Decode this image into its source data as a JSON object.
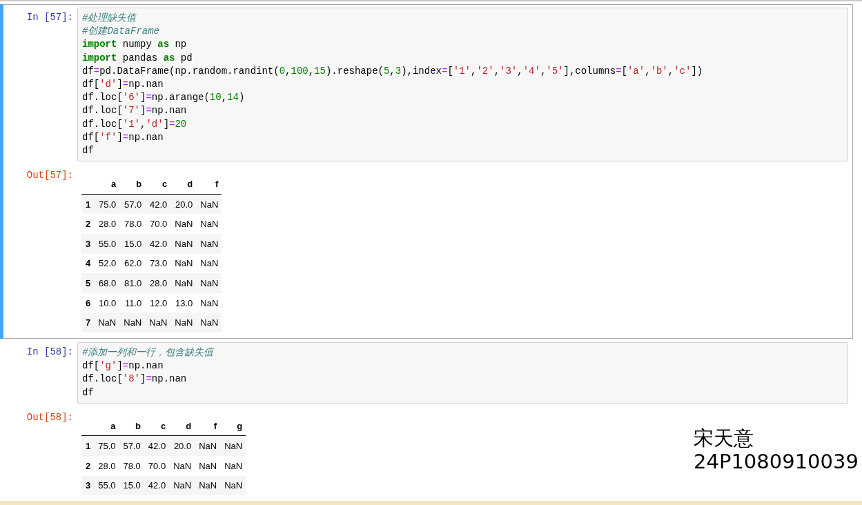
{
  "cells": [
    {
      "selected": true,
      "in_prompt": "In [57]:",
      "code": [
        [
          {
            "kind": "comment",
            "text": "#处理缺失值"
          }
        ],
        [
          {
            "kind": "comment",
            "text": "#创建DataFrame"
          }
        ],
        [
          {
            "kind": "keyword",
            "text": "import"
          },
          {
            "kind": "name",
            "text": " numpy "
          },
          {
            "kind": "keyword",
            "text": "as"
          },
          {
            "kind": "name",
            "text": " np"
          }
        ],
        [
          {
            "kind": "keyword",
            "text": "import"
          },
          {
            "kind": "name",
            "text": " pandas "
          },
          {
            "kind": "keyword",
            "text": "as"
          },
          {
            "kind": "name",
            "text": " pd"
          }
        ],
        [
          {
            "kind": "name",
            "text": "df"
          },
          {
            "kind": "operator",
            "text": "="
          },
          {
            "kind": "name",
            "text": "pd.DataFrame(np.random.randint("
          },
          {
            "kind": "number",
            "text": "0"
          },
          {
            "kind": "name",
            "text": ","
          },
          {
            "kind": "number",
            "text": "100"
          },
          {
            "kind": "name",
            "text": ","
          },
          {
            "kind": "number",
            "text": "15"
          },
          {
            "kind": "name",
            "text": ").reshape("
          },
          {
            "kind": "number",
            "text": "5"
          },
          {
            "kind": "name",
            "text": ","
          },
          {
            "kind": "number",
            "text": "3"
          },
          {
            "kind": "name",
            "text": "),index"
          },
          {
            "kind": "operator",
            "text": "="
          },
          {
            "kind": "name",
            "text": "["
          },
          {
            "kind": "string",
            "text": "'1'"
          },
          {
            "kind": "name",
            "text": ","
          },
          {
            "kind": "string",
            "text": "'2'"
          },
          {
            "kind": "name",
            "text": ","
          },
          {
            "kind": "string",
            "text": "'3'"
          },
          {
            "kind": "name",
            "text": ","
          },
          {
            "kind": "string",
            "text": "'4'"
          },
          {
            "kind": "name",
            "text": ","
          },
          {
            "kind": "string",
            "text": "'5'"
          },
          {
            "kind": "name",
            "text": "],columns"
          },
          {
            "kind": "operator",
            "text": "="
          },
          {
            "kind": "name",
            "text": "["
          },
          {
            "kind": "string",
            "text": "'a'"
          },
          {
            "kind": "name",
            "text": ","
          },
          {
            "kind": "string",
            "text": "'b'"
          },
          {
            "kind": "name",
            "text": ","
          },
          {
            "kind": "string",
            "text": "'c'"
          },
          {
            "kind": "name",
            "text": "])"
          }
        ],
        [
          {
            "kind": "name",
            "text": "df["
          },
          {
            "kind": "string",
            "text": "'d'"
          },
          {
            "kind": "name",
            "text": "]"
          },
          {
            "kind": "operator",
            "text": "="
          },
          {
            "kind": "name",
            "text": "np.nan"
          }
        ],
        [
          {
            "kind": "name",
            "text": "df.loc["
          },
          {
            "kind": "string",
            "text": "'6'"
          },
          {
            "kind": "name",
            "text": "]"
          },
          {
            "kind": "operator",
            "text": "="
          },
          {
            "kind": "name",
            "text": "np.arange("
          },
          {
            "kind": "number",
            "text": "10"
          },
          {
            "kind": "name",
            "text": ","
          },
          {
            "kind": "number",
            "text": "14"
          },
          {
            "kind": "name",
            "text": ")"
          }
        ],
        [
          {
            "kind": "name",
            "text": "df.loc["
          },
          {
            "kind": "string",
            "text": "'7'"
          },
          {
            "kind": "name",
            "text": "]"
          },
          {
            "kind": "operator",
            "text": "="
          },
          {
            "kind": "name",
            "text": "np.nan"
          }
        ],
        [
          {
            "kind": "name",
            "text": "df.loc["
          },
          {
            "kind": "string",
            "text": "'1'"
          },
          {
            "kind": "name",
            "text": ","
          },
          {
            "kind": "string",
            "text": "'d'"
          },
          {
            "kind": "name",
            "text": "]"
          },
          {
            "kind": "operator",
            "text": "="
          },
          {
            "kind": "number",
            "text": "20"
          }
        ],
        [
          {
            "kind": "name",
            "text": "df["
          },
          {
            "kind": "string",
            "text": "'f'"
          },
          {
            "kind": "name",
            "text": "]"
          },
          {
            "kind": "operator",
            "text": "="
          },
          {
            "kind": "name",
            "text": "np.nan"
          }
        ],
        [
          {
            "kind": "name",
            "text": "df"
          }
        ]
      ],
      "out_prompt": "Out[57]:",
      "table": {
        "columns": [
          "a",
          "b",
          "c",
          "d",
          "f"
        ],
        "rows": [
          {
            "index": "1",
            "values": [
              "75.0",
              "57.0",
              "42.0",
              "20.0",
              "NaN"
            ]
          },
          {
            "index": "2",
            "values": [
              "28.0",
              "78.0",
              "70.0",
              "NaN",
              "NaN"
            ]
          },
          {
            "index": "3",
            "values": [
              "55.0",
              "15.0",
              "42.0",
              "NaN",
              "NaN"
            ]
          },
          {
            "index": "4",
            "values": [
              "52.0",
              "62.0",
              "73.0",
              "NaN",
              "NaN"
            ]
          },
          {
            "index": "5",
            "values": [
              "68.0",
              "81.0",
              "28.0",
              "NaN",
              "NaN"
            ]
          },
          {
            "index": "6",
            "values": [
              "10.0",
              "11.0",
              "12.0",
              "13.0",
              "NaN"
            ]
          },
          {
            "index": "7",
            "values": [
              "NaN",
              "NaN",
              "NaN",
              "NaN",
              "NaN"
            ]
          }
        ]
      }
    },
    {
      "selected": false,
      "in_prompt": "In [58]:",
      "code": [
        [
          {
            "kind": "comment",
            "text": "#添加一列和一行，包含缺失值"
          }
        ],
        [
          {
            "kind": "name",
            "text": "df["
          },
          {
            "kind": "string",
            "text": "'g'"
          },
          {
            "kind": "name",
            "text": "]"
          },
          {
            "kind": "operator",
            "text": "="
          },
          {
            "kind": "name",
            "text": "np.nan"
          }
        ],
        [
          {
            "kind": "name",
            "text": "df.loc["
          },
          {
            "kind": "string",
            "text": "'8'"
          },
          {
            "kind": "name",
            "text": "]"
          },
          {
            "kind": "operator",
            "text": "="
          },
          {
            "kind": "name",
            "text": "np.nan"
          }
        ],
        [
          {
            "kind": "name",
            "text": "df"
          }
        ]
      ],
      "out_prompt": "Out[58]:",
      "table": {
        "columns": [
          "a",
          "b",
          "c",
          "d",
          "f",
          "g"
        ],
        "rows": [
          {
            "index": "1",
            "values": [
              "75.0",
              "57.0",
              "42.0",
              "20.0",
              "NaN",
              "NaN"
            ]
          },
          {
            "index": "2",
            "values": [
              "28.0",
              "78.0",
              "70.0",
              "NaN",
              "NaN",
              "NaN"
            ]
          },
          {
            "index": "3",
            "values": [
              "55.0",
              "15.0",
              "42.0",
              "NaN",
              "NaN",
              "NaN"
            ]
          }
        ]
      }
    }
  ],
  "overlay_text": [
    "宋天意",
    "24P1080910039"
  ]
}
